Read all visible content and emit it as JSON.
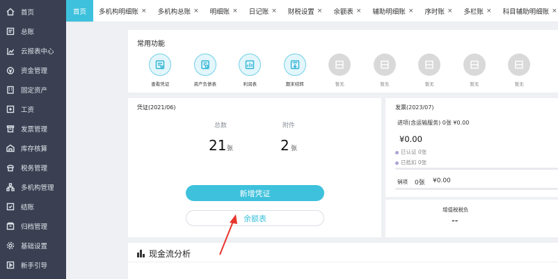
{
  "sidebar": {
    "items": [
      {
        "label": "首页",
        "icon": "home-icon"
      },
      {
        "label": "总账",
        "icon": "ledger-icon"
      },
      {
        "label": "云报表中心",
        "icon": "chart-icon"
      },
      {
        "label": "资金管理",
        "icon": "money-icon"
      },
      {
        "label": "固定资产",
        "icon": "building-icon"
      },
      {
        "label": "工资",
        "icon": "salary-icon"
      },
      {
        "label": "发票管理",
        "icon": "invoice-icon"
      },
      {
        "label": "库存核算",
        "icon": "warehouse-icon"
      },
      {
        "label": "税务管理",
        "icon": "tax-icon"
      },
      {
        "label": "多机构管理",
        "icon": "org-icon"
      },
      {
        "label": "结账",
        "icon": "closing-icon"
      },
      {
        "label": "归档管理",
        "icon": "archive-icon"
      },
      {
        "label": "基础设置",
        "icon": "gear-icon"
      },
      {
        "label": "新手引导",
        "icon": "guide-icon"
      }
    ]
  },
  "tabs": [
    {
      "label": "首页",
      "active": true
    },
    {
      "label": "多机构明细账",
      "close": "×"
    },
    {
      "label": "多机构总账",
      "close": "×"
    },
    {
      "label": "明细账",
      "close": "×"
    },
    {
      "label": "日记账",
      "close": "×"
    },
    {
      "label": "财税设置",
      "close": "×"
    },
    {
      "label": "余额表",
      "close": "×"
    },
    {
      "label": "辅助明细账",
      "close": "×"
    },
    {
      "label": "序时账",
      "close": "×"
    },
    {
      "label": "多栏账",
      "close": "×"
    },
    {
      "label": "科目辅助明细账",
      "close": "×"
    }
  ],
  "common_functions": {
    "title": "常用功能",
    "items": [
      {
        "label": "查看凭证",
        "enabled": true,
        "icon": "voucher-view-icon"
      },
      {
        "label": "资产负债表",
        "enabled": true,
        "icon": "balance-sheet-icon"
      },
      {
        "label": "利润表",
        "enabled": true,
        "icon": "profit-statement-icon"
      },
      {
        "label": "期末结转",
        "enabled": true,
        "icon": "period-end-icon"
      },
      {
        "label": "暂无",
        "enabled": false,
        "icon": "empty-slot-icon"
      },
      {
        "label": "暂无",
        "enabled": false,
        "icon": "empty-slot-icon"
      },
      {
        "label": "暂无",
        "enabled": false,
        "icon": "empty-slot-icon"
      },
      {
        "label": "暂无",
        "enabled": false,
        "icon": "empty-slot-icon"
      },
      {
        "label": "暂无",
        "enabled": false,
        "icon": "empty-slot-icon"
      },
      {
        "label": "暂无",
        "enabled": false,
        "icon": "empty-slot-icon"
      }
    ]
  },
  "voucher": {
    "title": "凭证(2021/06)",
    "total_label": "总数",
    "total_value": "21",
    "total_unit": "张",
    "attach_label": "附件",
    "attach_value": "2",
    "attach_unit": "张",
    "add_button": "新增凭证",
    "balance_button": "余额表"
  },
  "invoice": {
    "title": "发票(2023/07)",
    "input_label": "进项(含运输服务) 0张  ¥0.00",
    "input_amount": "¥0.00",
    "certified": "已认证  0张",
    "deducted": "已抵扣  0张",
    "output_label": "销项",
    "output_count": "0张",
    "output_amount": "¥0.00"
  },
  "vat": {
    "title": "增值税税负",
    "value": "--"
  },
  "cash_flow": {
    "title": "现金流分析"
  },
  "colors": {
    "accent": "#3ec1dc",
    "sidebar_bg": "#3a3f51",
    "annotation_arrow": "#e8342b"
  }
}
